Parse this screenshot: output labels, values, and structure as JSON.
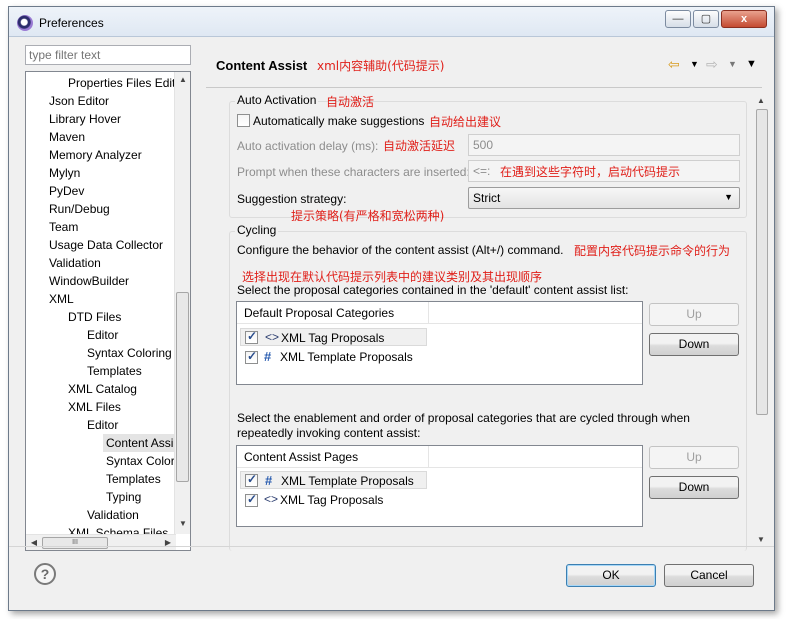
{
  "window": {
    "title": "Preferences",
    "close_label": "x",
    "min_label": "—",
    "max_label": "▢"
  },
  "filter": {
    "placeholder": "type filter text"
  },
  "tree": {
    "items": [
      {
        "label": "Properties Files Edito"
      },
      {
        "label": "Json Editor"
      },
      {
        "label": "Library Hover"
      },
      {
        "label": "Maven"
      },
      {
        "label": "Memory Analyzer"
      },
      {
        "label": "Mylyn"
      },
      {
        "label": "PyDev"
      },
      {
        "label": "Run/Debug"
      },
      {
        "label": "Team"
      },
      {
        "label": "Usage Data Collector"
      },
      {
        "label": "Validation"
      },
      {
        "label": "WindowBuilder"
      },
      {
        "label": "XML"
      },
      {
        "label": "DTD Files"
      },
      {
        "label": "Editor"
      },
      {
        "label": "Syntax Coloring"
      },
      {
        "label": "Templates"
      },
      {
        "label": "XML Catalog"
      },
      {
        "label": "XML Files"
      },
      {
        "label": "Editor"
      },
      {
        "label": "Content Assi"
      },
      {
        "label": "Syntax Colori"
      },
      {
        "label": "Templates"
      },
      {
        "label": "Typing"
      },
      {
        "label": "Validation"
      },
      {
        "label": "XML Schema Files"
      }
    ],
    "hscroll_grip": "III"
  },
  "page": {
    "title": "Content Assist",
    "annotation": "xml内容辅助(代码提示)"
  },
  "auto_activation": {
    "group_label": "Auto Activation",
    "group_annotation": "自动激活",
    "make_suggestions_label": "Automatically make suggestions",
    "make_suggestions_annotation": "自动给出建议",
    "make_suggestions_checked": false,
    "delay_label": "Auto activation delay (ms):",
    "delay_annotation": "自动激活延迟",
    "delay_value": "500",
    "prompt_label": "Prompt when these characters are inserted:",
    "prompt_value": "<=:",
    "prompt_annotation": "在遇到这些字符时，启动代码提示",
    "strategy_label": "Suggestion strategy:",
    "strategy_value": "Strict",
    "strategy_annotation": "提示策略(有严格和宽松两种)"
  },
  "cycling": {
    "group_label": "Cycling",
    "description": "Configure the behavior of the content assist (Alt+/) command.",
    "description_annotation": "配置内容代码提示命令的行为",
    "default_annotation": "选择出现在默认代码提示列表中的建议类别及其出现顺序",
    "default_list_label": "Select the proposal categories contained in the 'default' content assist list:",
    "default_table_header": "Default Proposal Categories",
    "default_rows": [
      {
        "icon": "xml-tag-icon",
        "glyph": "<>",
        "label": "XML Tag Proposals",
        "checked": true
      },
      {
        "icon": "template-hash-icon",
        "glyph": "#",
        "label": "XML Template Proposals",
        "checked": true
      }
    ],
    "cycle_list_label_1": "Select the enablement and order of proposal categories that are cycled through when",
    "cycle_list_label_2": "repeatedly invoking content assist:",
    "cycle_table_header": "Content Assist Pages",
    "cycle_rows": [
      {
        "icon": "template-hash-icon",
        "glyph": "#",
        "label": "XML Template Proposals",
        "checked": true
      },
      {
        "icon": "xml-tag-icon",
        "glyph": "<>",
        "label": "XML Tag Proposals",
        "checked": true
      }
    ],
    "up_label": "Up",
    "down_label": "Down"
  },
  "footer": {
    "help_label": "?",
    "ok_label": "OK",
    "cancel_label": "Cancel"
  },
  "nav": {
    "back_glyph": "⇦",
    "forward_glyph": "⇨",
    "menu_glyph": "▼"
  },
  "colors": {
    "annotation": "#e0201a",
    "accent": "#3c7fb1"
  }
}
